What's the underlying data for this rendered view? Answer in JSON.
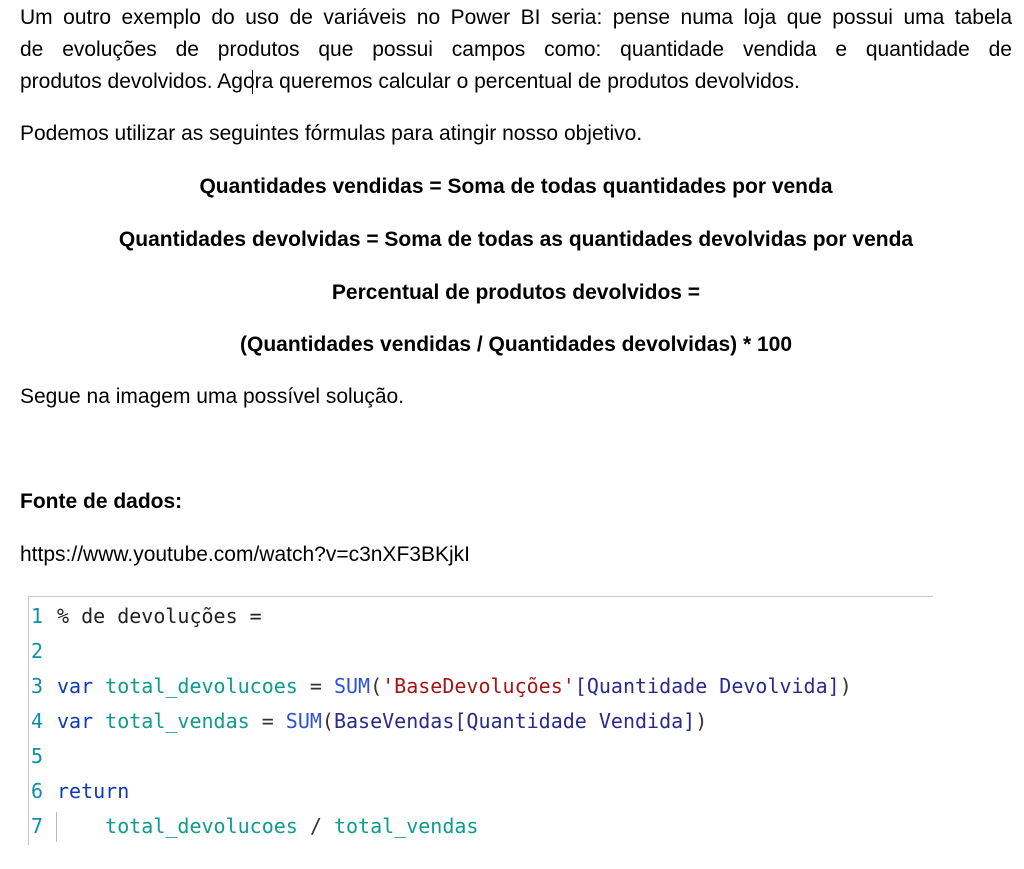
{
  "paragraphs": {
    "intro_line1": "Um outro exemplo do uso de variáveis no Power BI seria: pense numa loja que possui uma tabela",
    "intro_line2": "de evoluções de produtos que possui campos como: quantidade vendida e quantidade de",
    "intro_line3": "produtos devolvidos. Agora queremos calcular o percentual de produtos devolvidos.",
    "formulas_intro": "Podemos utilizar as seguintes fórmulas para atingir nosso objetivo.",
    "solution": "Segue na imagem uma possível solução."
  },
  "formulas": [
    "Quantidades vendidas = Soma de todas quantidades por venda",
    "Quantidades devolvidas = Soma de todas as quantidades devolvidas por venda",
    "Percentual de produtos devolvidos =",
    "(Quantidades vendidas / Quantidades devolvidas) * 100"
  ],
  "source": {
    "heading": "Fonte de dados:",
    "url": "https://www.youtube.com/watch?v=c3nXF3BKjkI"
  },
  "code": {
    "line_numbers": [
      "1",
      "2",
      "3",
      "4",
      "5",
      "6",
      "7"
    ],
    "l1": "% de devoluções =",
    "l3_kw": "var",
    "l3_var": "total_devolucoes",
    "l3_eq": " = ",
    "l3_fn": "SUM",
    "l3_open": "(",
    "l3_table": "'BaseDevoluções'",
    "l3_col": "[Quantidade Devolvida]",
    "l3_close": ")",
    "l4_kw": "var",
    "l4_var": "total_vendas",
    "l4_eq": " = ",
    "l4_fn": "SUM",
    "l4_open": "(",
    "l4_table": "BaseVendas",
    "l4_col": "[Quantidade Vendida]",
    "l4_close": ")",
    "l6_kw": "return",
    "l7_var1": "total_devolucoes",
    "l7_op": " / ",
    "l7_var2": "total_vendas"
  }
}
